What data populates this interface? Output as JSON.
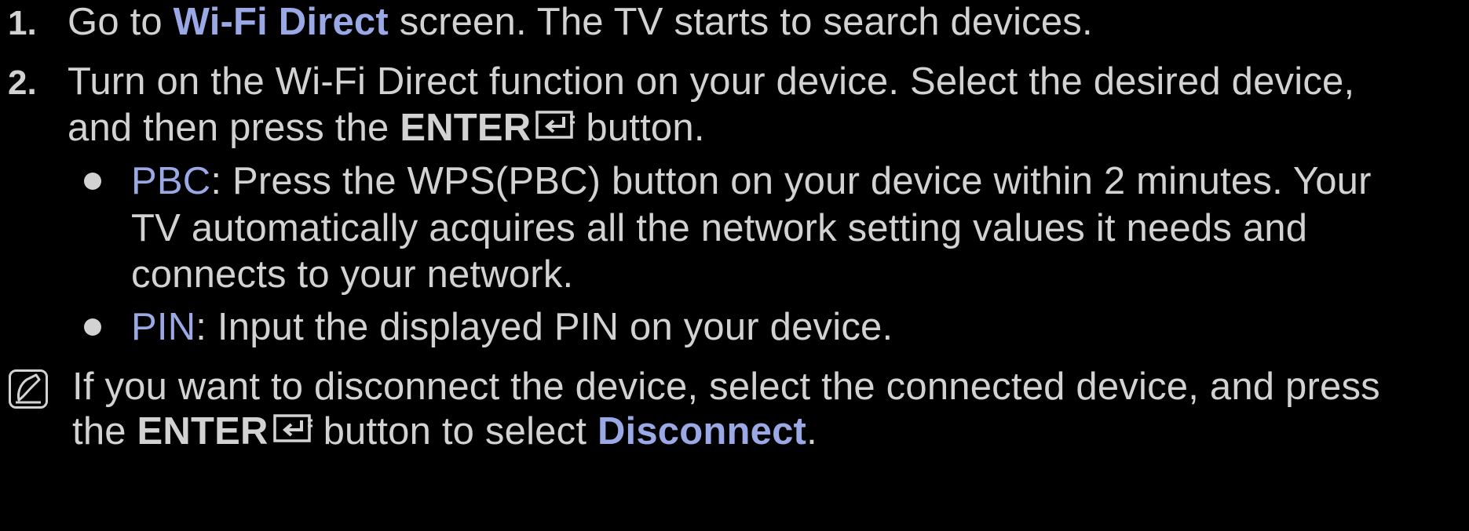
{
  "colors": {
    "background": "#000000",
    "text": "#d2d2d2",
    "highlight": "#9aa8e6"
  },
  "steps": [
    {
      "number": "1.",
      "prefix": "Go to ",
      "link": "Wi-Fi Direct",
      "suffix": " screen. The TV starts to search devices."
    },
    {
      "number": "2.",
      "line1": "Turn on the Wi-Fi Direct function on your device. Select the desired device,",
      "line2_prefix": "and then press the ",
      "enter_label": "ENTER",
      "enter_icon": "enter-icon",
      "line2_suffix": "button."
    }
  ],
  "bullets": [
    {
      "term": "PBC",
      "line1": ": Press the WPS(PBC) button on your device within 2 minutes. Your",
      "line2": "TV automatically acquires all the network setting values it needs and",
      "line3": "connects to your network."
    },
    {
      "term": "PIN",
      "line1": ": Input the displayed PIN on your device."
    }
  ],
  "note": {
    "icon": "note-icon",
    "line1": "If you want to disconnect the device, select the connected device, and press",
    "line2_prefix": "the ",
    "enter_label": "ENTER",
    "enter_icon": "enter-icon",
    "line2_mid": "button to select ",
    "link": "Disconnect",
    "line2_suffix": "."
  }
}
